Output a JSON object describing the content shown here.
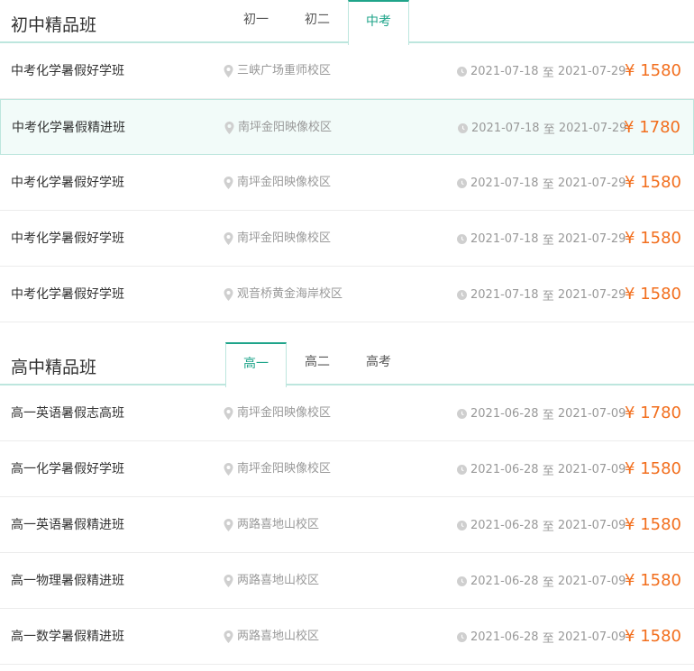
{
  "sections": [
    {
      "title": "初中精品班",
      "tabs": [
        "初一",
        "初二",
        "中考"
      ],
      "active_tab": 2,
      "rows": [
        {
          "name": "中考化学暑假好学班",
          "location": "三峡广场重师校区",
          "start": "2021-07-18",
          "sep": "至",
          "end": "2021-07-29",
          "price": "¥ 1580"
        },
        {
          "name": "中考化学暑假精进班",
          "location": "南坪金阳映像校区",
          "start": "2021-07-18",
          "sep": "至",
          "end": "2021-07-29",
          "price": "¥ 1780"
        },
        {
          "name": "中考化学暑假好学班",
          "location": "南坪金阳映像校区",
          "start": "2021-07-18",
          "sep": "至",
          "end": "2021-07-29",
          "price": "¥ 1580"
        },
        {
          "name": "中考化学暑假好学班",
          "location": "南坪金阳映像校区",
          "start": "2021-07-18",
          "sep": "至",
          "end": "2021-07-29",
          "price": "¥ 1580"
        },
        {
          "name": "中考化学暑假好学班",
          "location": "观音桥黄金海岸校区",
          "start": "2021-07-18",
          "sep": "至",
          "end": "2021-07-29",
          "price": "¥ 1580"
        }
      ]
    },
    {
      "title": "高中精品班",
      "tabs": [
        "高一",
        "高二",
        "高考"
      ],
      "active_tab": 0,
      "rows": [
        {
          "name": "高一英语暑假志高班",
          "location": "南坪金阳映像校区",
          "start": "2021-06-28",
          "sep": "至",
          "end": "2021-07-09",
          "price": "¥ 1780"
        },
        {
          "name": "高一化学暑假好学班",
          "location": "南坪金阳映像校区",
          "start": "2021-06-28",
          "sep": "至",
          "end": "2021-07-09",
          "price": "¥ 1580"
        },
        {
          "name": "高一英语暑假精进班",
          "location": "两路喜地山校区",
          "start": "2021-06-28",
          "sep": "至",
          "end": "2021-07-09",
          "price": "¥ 1580"
        },
        {
          "name": "高一物理暑假精进班",
          "location": "两路喜地山校区",
          "start": "2021-06-28",
          "sep": "至",
          "end": "2021-07-09",
          "price": "¥ 1580"
        },
        {
          "name": "高一数学暑假精进班",
          "location": "两路喜地山校区",
          "start": "2021-06-28",
          "sep": "至",
          "end": "2021-07-09",
          "price": "¥ 1580"
        }
      ]
    }
  ],
  "colors": {
    "accent": "#1fa48a",
    "price": "#f26e1d",
    "highlight_bg": "#f2fbf9"
  },
  "icons": {
    "location": "map-pin-icon",
    "time": "clock-icon"
  }
}
